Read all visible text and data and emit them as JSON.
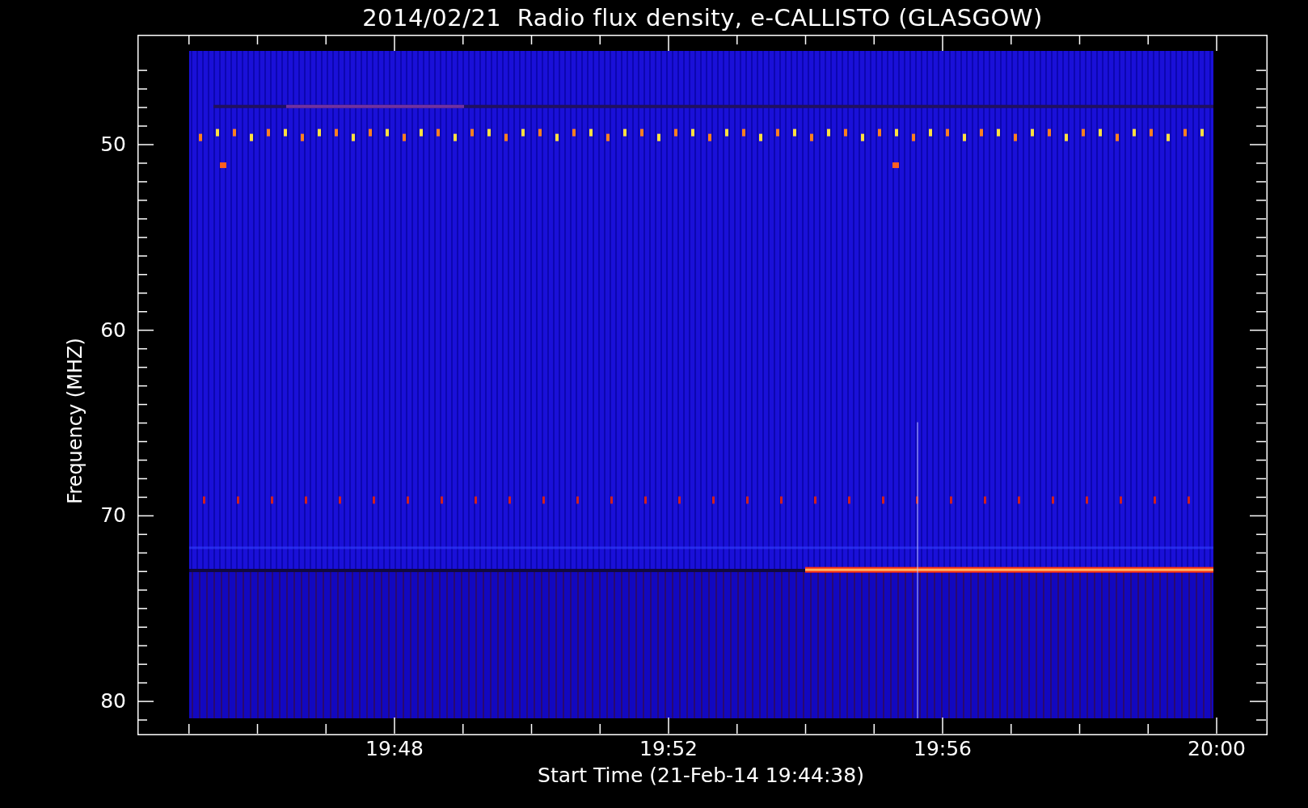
{
  "title": "2014/02/21  Radio flux density, e-CALLISTO (GLASGOW)",
  "y_axis": {
    "label": "Frequency (MHZ)",
    "ticks": [
      "50",
      "60",
      "70",
      "80"
    ]
  },
  "x_axis": {
    "label": "Start Time (21-Feb-14 19:44:38)",
    "ticks": [
      "19:48",
      "19:52",
      "19:56",
      "20:00"
    ]
  }
}
